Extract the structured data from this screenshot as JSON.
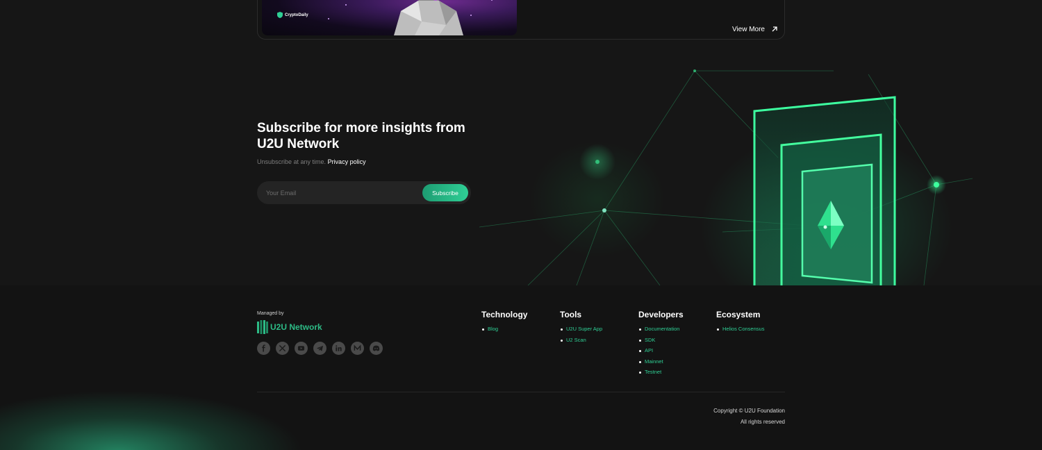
{
  "news_card": {
    "thumb_brand": "CryptoDaily",
    "view_more_label": "View More"
  },
  "subscribe": {
    "title": "Subscribe for more insights from U2U Network",
    "note": "Unsubscribe at any time.",
    "privacy_link": "Privacy policy",
    "email_placeholder": "Your Email",
    "button_label": "Subscribe"
  },
  "footer": {
    "managed_label": "Managed by",
    "brand_name": "U2U Network",
    "socials": [
      "facebook-icon",
      "x-icon",
      "youtube-icon",
      "telegram-icon",
      "linkedin-icon",
      "medium-icon",
      "discord-icon"
    ],
    "columns": {
      "technology": {
        "title": "Technology",
        "items": [
          "Blog"
        ]
      },
      "tools": {
        "title": "Tools",
        "items": [
          "U2U Super App",
          "U2 Scan"
        ]
      },
      "developers": {
        "title": "Developers",
        "items": [
          "Documentation",
          "SDK",
          "API",
          "Mainnet",
          "Testnet"
        ]
      },
      "ecosystem": {
        "title": "Ecosystem",
        "items": [
          "Helios Consensus"
        ]
      }
    },
    "copyright_line1": "Copyright © U2U Foundation",
    "copyright_line2": "All rights reserved"
  },
  "colors": {
    "accent": "#2fcf95",
    "brand_green": "#2dbb86",
    "background": "#161616"
  }
}
